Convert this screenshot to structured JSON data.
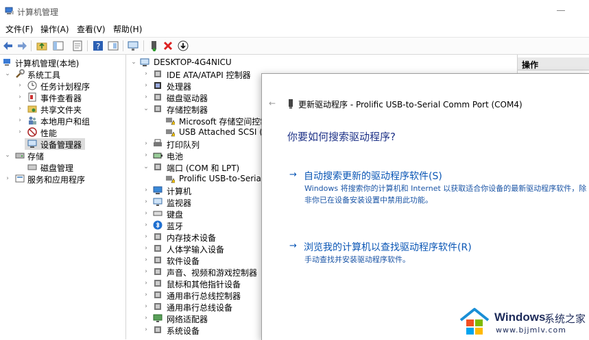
{
  "window": {
    "title": "计算机管理"
  },
  "menu": [
    {
      "label": "文件(F)"
    },
    {
      "label": "操作(A)"
    },
    {
      "label": "查看(V)"
    },
    {
      "label": "帮助(H)"
    }
  ],
  "left_tree": [
    {
      "label": "计算机管理(本地)",
      "icon": "computer-management-icon"
    },
    {
      "label": "系统工具",
      "icon": "tools-icon"
    },
    {
      "label": "任务计划程序",
      "icon": "clock-icon"
    },
    {
      "label": "事件查看器",
      "icon": "event-viewer-icon"
    },
    {
      "label": "共享文件夹",
      "icon": "shared-folder-icon"
    },
    {
      "label": "本地用户和组",
      "icon": "users-icon"
    },
    {
      "label": "性能",
      "icon": "performance-icon"
    },
    {
      "label": "设备管理器",
      "icon": "device-manager-icon"
    },
    {
      "label": "存储",
      "icon": "storage-icon"
    },
    {
      "label": "磁盘管理",
      "icon": "disk-icon"
    },
    {
      "label": "服务和应用程序",
      "icon": "services-icon"
    }
  ],
  "device_tree": {
    "root": "DESKTOP-4G4NICU",
    "items": [
      {
        "label": "IDE ATA/ATAPI 控制器",
        "icon": "ide-controller-icon"
      },
      {
        "label": "处理器",
        "icon": "processor-icon"
      },
      {
        "label": "磁盘驱动器",
        "icon": "disk-drive-icon"
      },
      {
        "label": "存储控制器",
        "icon": "storage-controller-icon"
      },
      {
        "label": "Microsoft 存储空间控制",
        "icon": "warning-device-icon"
      },
      {
        "label": "USB Attached SCSI (UA",
        "icon": "warning-device-icon"
      },
      {
        "label": "打印队列",
        "icon": "printer-icon"
      },
      {
        "label": "电池",
        "icon": "battery-icon"
      },
      {
        "label": "端口 (COM 和 LPT)",
        "icon": "port-icon"
      },
      {
        "label": "Prolific USB-to-Serial Co",
        "icon": "warning-device-icon"
      },
      {
        "label": "计算机",
        "icon": "computer-icon"
      },
      {
        "label": "监视器",
        "icon": "monitor-icon"
      },
      {
        "label": "键盘",
        "icon": "keyboard-icon"
      },
      {
        "label": "蓝牙",
        "icon": "bluetooth-icon"
      },
      {
        "label": "内存技术设备",
        "icon": "memory-icon"
      },
      {
        "label": "人体学输入设备",
        "icon": "hid-icon"
      },
      {
        "label": "软件设备",
        "icon": "software-device-icon"
      },
      {
        "label": "声音、视频和游戏控制器",
        "icon": "sound-icon"
      },
      {
        "label": "鼠标和其他指针设备",
        "icon": "mouse-icon"
      },
      {
        "label": "通用串行总线控制器",
        "icon": "usb-icon"
      },
      {
        "label": "通用串行总线设备",
        "icon": "usb-icon"
      },
      {
        "label": "网络适配器",
        "icon": "network-icon"
      },
      {
        "label": "系统设备",
        "icon": "system-device-icon"
      }
    ]
  },
  "actions": {
    "header": "操作"
  },
  "dialog": {
    "back": "←",
    "title": "更新驱动程序 - Prolific USB-to-Serial Comm Port (COM4)",
    "question": "你要如何搜索驱动程序?",
    "option_arrow": "→",
    "option1": {
      "title": "自动搜索更新的驱动程序软件(S)",
      "desc_line1": "Windows 将搜索你的计算机和 Internet 以获取适合你设备的最新驱动程序软件，除",
      "desc_line2": "非你已在设备安装设置中禁用此功能。"
    },
    "option2": {
      "title": "浏览我的计算机以查找驱动程序软件(R)",
      "desc": "手动查找并安装驱动程序软件。"
    }
  },
  "watermark": {
    "brand": "Windows",
    "cn": "系统之家",
    "url": "www.bjjmlv.com",
    "colors": [
      "#f25022",
      "#7fba00",
      "#00a4ef",
      "#ffb900"
    ]
  }
}
